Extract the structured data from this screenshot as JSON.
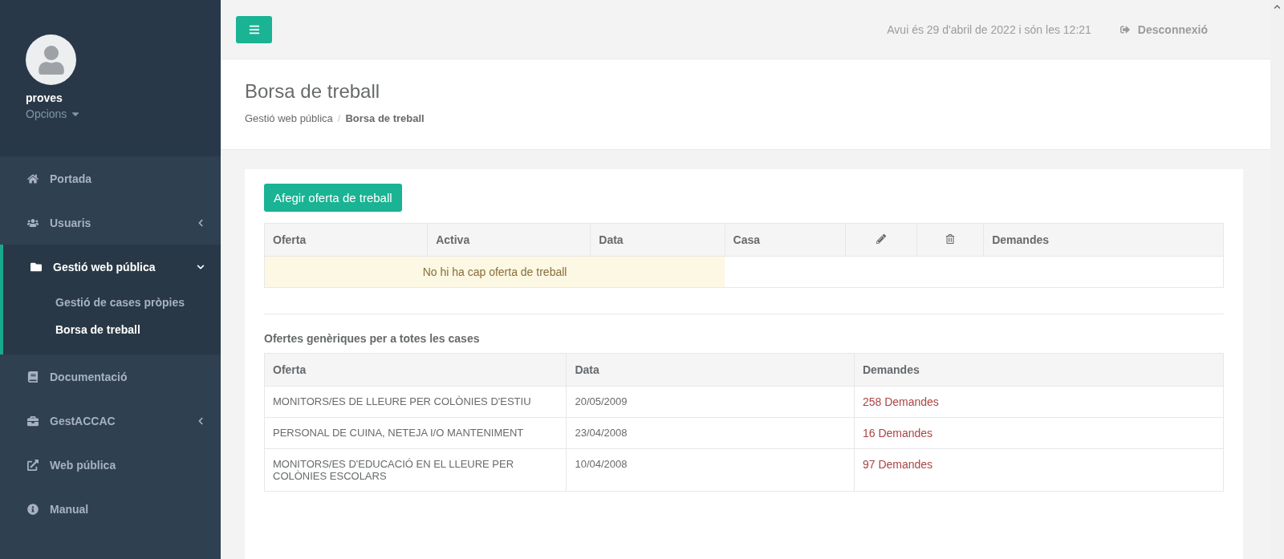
{
  "profile": {
    "name": "proves",
    "menu_label": "Opcions"
  },
  "sidebar": {
    "items": [
      {
        "label": "Portada",
        "expandable": false,
        "expanded": false
      },
      {
        "label": "Usuaris",
        "expandable": true,
        "expanded": false
      },
      {
        "label": "Gestió web pública",
        "expandable": true,
        "expanded": true,
        "children": [
          {
            "label": "Gestió de cases pròpies",
            "selected": false
          },
          {
            "label": "Borsa de treball",
            "selected": true
          }
        ]
      },
      {
        "label": "Documentació",
        "expandable": false,
        "expanded": false
      },
      {
        "label": "GestACCAC",
        "expandable": true,
        "expanded": false
      },
      {
        "label": "Web pública",
        "expandable": false,
        "expanded": false
      },
      {
        "label": "Manual",
        "expandable": false,
        "expanded": false
      }
    ]
  },
  "topbar": {
    "datetime": "Avui és 29 d'abril de 2022 i són les 12:21",
    "logout": "Desconnexió"
  },
  "page": {
    "title": "Borsa de treball",
    "breadcrumb": [
      "Gestió web pública",
      "Borsa de treball"
    ],
    "breadcrumb_separator": "/"
  },
  "add_button": "Afegir oferta de treball",
  "offers_table": {
    "columns": [
      {
        "kind": "text",
        "label": "Oferta"
      },
      {
        "kind": "text",
        "label": "Activa"
      },
      {
        "kind": "text",
        "label": "Data"
      },
      {
        "kind": "text",
        "label": "Casa"
      },
      {
        "kind": "edit"
      },
      {
        "kind": "delete"
      },
      {
        "kind": "text",
        "label": "Demandes"
      }
    ],
    "empty_message": "No hi ha cap oferta de treball"
  },
  "generic_section": {
    "title": "Ofertes genèriques per a totes les cases",
    "columns": [
      "Oferta",
      "Data",
      "Demandes"
    ],
    "rows": [
      {
        "offer": "MONITORS/ES DE LLEURE PER COLÒNIES D'ESTIU",
        "date": "20/05/2009",
        "requests": "258 Demandes"
      },
      {
        "offer": "PERSONAL DE CUINA, NETEJA I/O MANTENIMENT",
        "date": "23/04/2008",
        "requests": "16 Demandes"
      },
      {
        "offer": "MONITORS/ES D'EDUCACIÓ EN EL LLEURE PER COLÒNIES ESCOLARS",
        "date": "10/04/2008",
        "requests": "97 Demandes"
      }
    ]
  }
}
